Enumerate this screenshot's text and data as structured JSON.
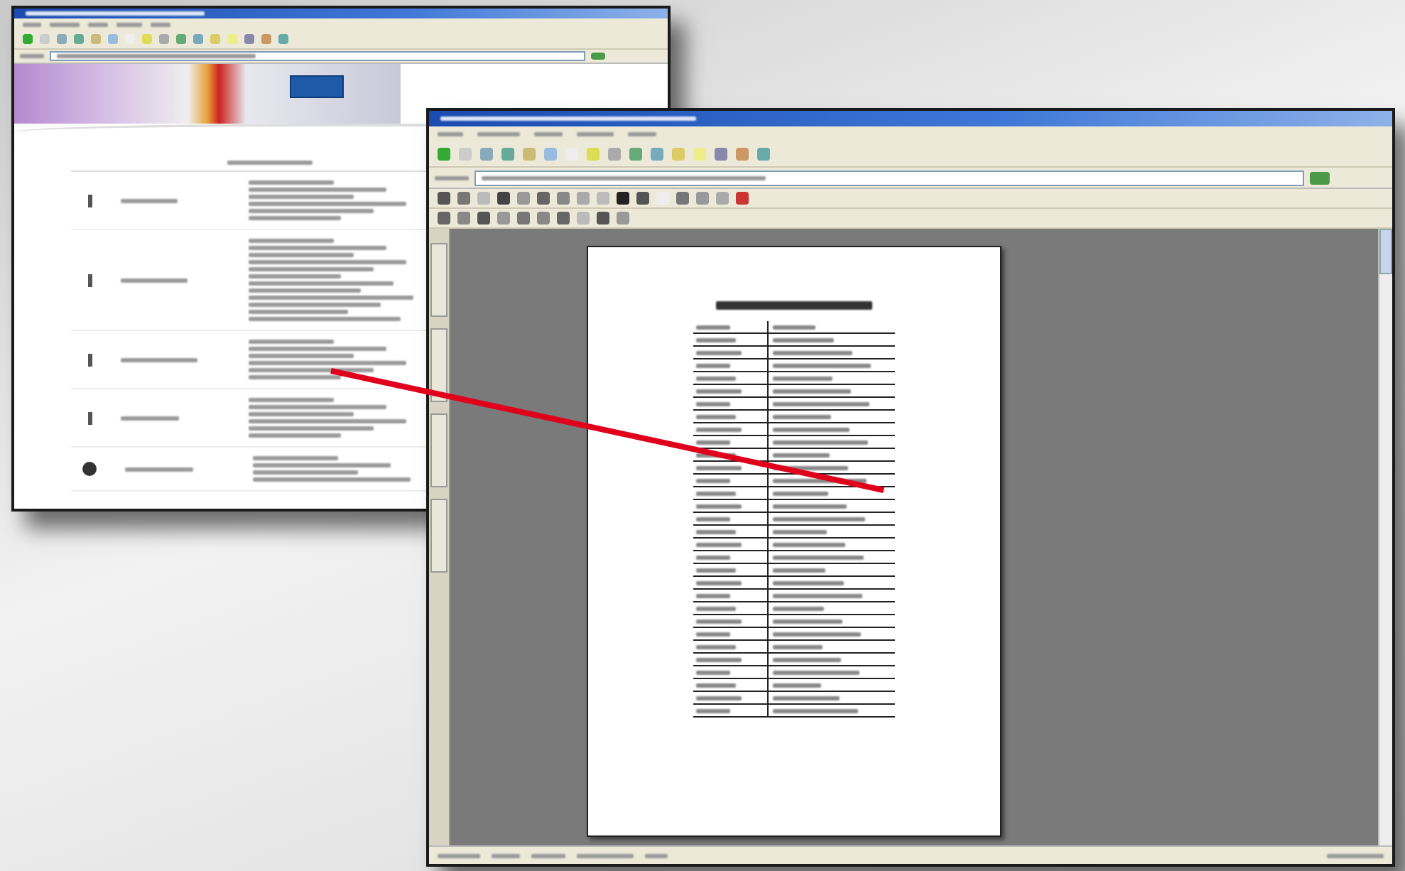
{
  "windows": [
    {
      "kind": "website"
    },
    {
      "kind": "pdf-viewer"
    }
  ],
  "connector": {
    "color": "#e0001b"
  }
}
